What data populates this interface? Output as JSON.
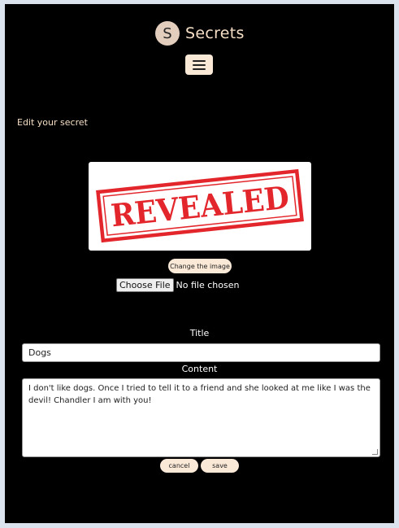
{
  "header": {
    "logo_letter": "S",
    "brand_name": "Secrets",
    "menu_icon": "hamburger-menu-icon"
  },
  "page": {
    "heading": "Edit your secret"
  },
  "image": {
    "stamp_text": "REVEALED",
    "stamp_color": "#e3262b",
    "change_label": "Change the image"
  },
  "file_input": {
    "button_label": "Choose File",
    "status": "No file chosen"
  },
  "form": {
    "title_label": "Title",
    "title_value": "Dogs",
    "content_label": "Content",
    "content_value": "I don't like dogs. Once I tried to tell it to a friend and she looked at me like I was the devil! Chandler I am with you!"
  },
  "actions": {
    "cancel_label": "cancel",
    "save_label": "save"
  },
  "colors": {
    "background": "#000000",
    "accent": "#fbe9d8",
    "brand_text": "#f6dfc6"
  }
}
